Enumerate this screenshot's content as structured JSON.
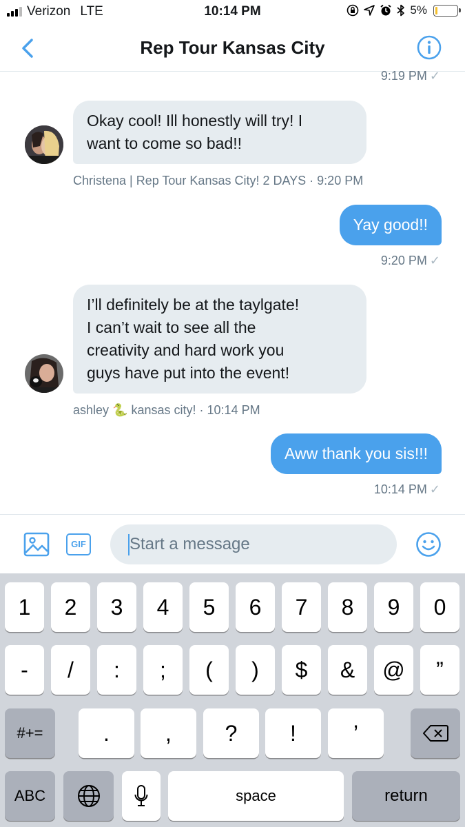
{
  "status_bar": {
    "carrier": "Verizon",
    "network": "LTE",
    "time": "10:14 PM",
    "battery": "5%",
    "battery_level": 0.05,
    "signal_bars": 3
  },
  "nav": {
    "title": "Rep Tour Kansas City",
    "back_icon": "chevron-left-icon",
    "info_icon": "info-icon",
    "accent": "#4aa1ec"
  },
  "messages": [
    {
      "time": "9:19 PM",
      "check": "✓"
    },
    {
      "text": "Okay cool! Ill honestly will try! I want to come so bad!!",
      "lines": [
        "Okay cool! Ill honestly will try! I",
        "want to come so bad!!"
      ],
      "sender": "Christena | Rep Tour Kansas City! 2 DAYS",
      "time": "9:20 PM"
    },
    {
      "text": "Yay good!!",
      "time": "9:20 PM",
      "check": "✓"
    },
    {
      "text": "I’ll definitely be at the taylgate! I can’t wait to see all the creativity and hard work you guys have put into the event!",
      "lines": [
        "I’ll definitely be at the taylgate!",
        "I can’t wait to see all the",
        "creativity and hard work you",
        "guys have put into the event!"
      ],
      "sender_before": "ashley",
      "sender_emoji": "🐍",
      "sender_after": "kansas city!",
      "time": "10:14 PM"
    },
    {
      "text": "Aww thank you sis!!!",
      "time": "10:14 PM",
      "check": "✓"
    }
  ],
  "composer": {
    "placeholder": "Start a message",
    "gif_label": "GIF",
    "image_icon": "image-icon",
    "emoji_icon": "smiley-icon"
  },
  "keyboard": {
    "row1": [
      "1",
      "2",
      "3",
      "4",
      "5",
      "6",
      "7",
      "8",
      "9",
      "0"
    ],
    "row2": [
      "-",
      "/",
      ":",
      ";",
      "(",
      ")",
      "$",
      "&",
      "@",
      "”"
    ],
    "row3_left": "#+=",
    "row3": [
      ".",
      ",",
      "?",
      "!",
      "’"
    ],
    "row4_left": "ABC",
    "space": "space",
    "return": "return"
  }
}
